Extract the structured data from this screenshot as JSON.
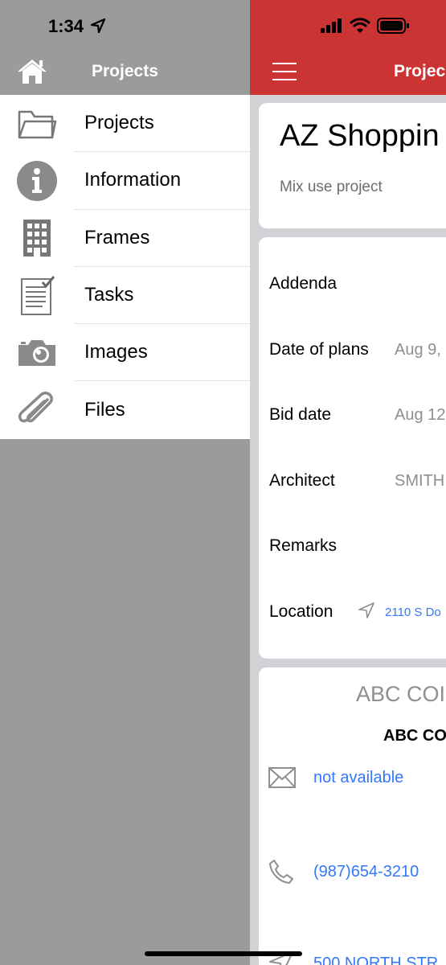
{
  "status": {
    "time": "1:34"
  },
  "drawer": {
    "title": "Projects",
    "items": [
      {
        "label": "Projects",
        "icon": "folder-icon"
      },
      {
        "label": "Information",
        "icon": "info-icon"
      },
      {
        "label": "Frames",
        "icon": "building-icon"
      },
      {
        "label": "Tasks",
        "icon": "checklist-icon"
      },
      {
        "label": "Images",
        "icon": "camera-icon"
      },
      {
        "label": "Files",
        "icon": "paperclip-icon"
      }
    ]
  },
  "main": {
    "title": "Projec",
    "project_name": "AZ Shoppin",
    "project_description": "Mix use project",
    "details": [
      {
        "key": "Addenda",
        "value": ""
      },
      {
        "key": "Date of plans",
        "value": "Aug 9,"
      },
      {
        "key": "Bid date",
        "value": "Aug 12"
      },
      {
        "key": "Architect",
        "value": "SMITH"
      },
      {
        "key": "Remarks",
        "value": ""
      },
      {
        "key": "Location",
        "value": "2110 S Do"
      }
    ],
    "company_name": "ABC COI",
    "company_name_bold": "ABC CO",
    "email": "not available",
    "phone": "(987)654-3210",
    "address": "500 NORTH STR"
  },
  "colors": {
    "header_red": "#cc3333",
    "link_blue": "#3478f6",
    "drawer_grey": "#9b9b9b"
  }
}
